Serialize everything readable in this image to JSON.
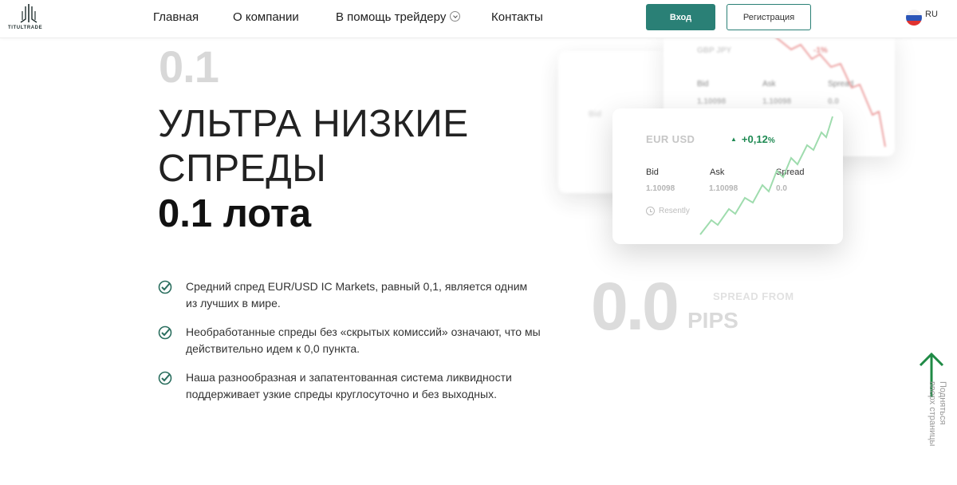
{
  "header": {
    "logo_text": "TITULTRADE",
    "nav": [
      {
        "label": "Главная"
      },
      {
        "label": "О компании"
      },
      {
        "label": "В помощь трейдеру"
      },
      {
        "label": "Контакты"
      }
    ],
    "login_label": "Вход",
    "register_label": "Регистрация",
    "language": "RU",
    "accent_color": "#2a8076"
  },
  "hero": {
    "big_number": "0.1",
    "headline_line1": "УЛЬТРА НИЗКИЕ",
    "headline_line2": "СПРЕДЫ",
    "headline_bold": "0.1 лота",
    "features": [
      {
        "text": "Средний спред EUR/USD IC Markets, равный 0,1, является одним из лучших в мире."
      },
      {
        "text": "Необработанные спреды без «скрытых комиссий» означают, что мы действительно идем к 0,0 пункта."
      },
      {
        "text": "Наша разнообразная и запатентованная система ликвидности поддерживает узкие спреды круглосуточно и без выходных."
      }
    ]
  },
  "quote_card": {
    "pair": "EUR USD",
    "change": "+0,12",
    "change_unit": "%",
    "bid_label": "Bid",
    "ask_label": "Ask",
    "spread_label": "Spread",
    "bid": "1.10098",
    "ask": "1.10098",
    "spread": "0.0",
    "recent_label": "Resently",
    "up_color": "#1f8a53"
  },
  "back_card": {
    "pair": "GBP JPY",
    "change": "-1%",
    "bid_label": "Bid",
    "ask_label": "Ask",
    "spread_label": "Spread",
    "bid": "1.10098",
    "ask": "1.10098",
    "spread": "0.0",
    "down_color": "#e05a5a"
  },
  "spread_badge": {
    "value": "0.0",
    "label_top": "SPREAD FROM",
    "label_bottom": "PIPS"
  },
  "scroll_up": {
    "label_line1": "Подняться",
    "label_line2": "вверх страницы"
  }
}
